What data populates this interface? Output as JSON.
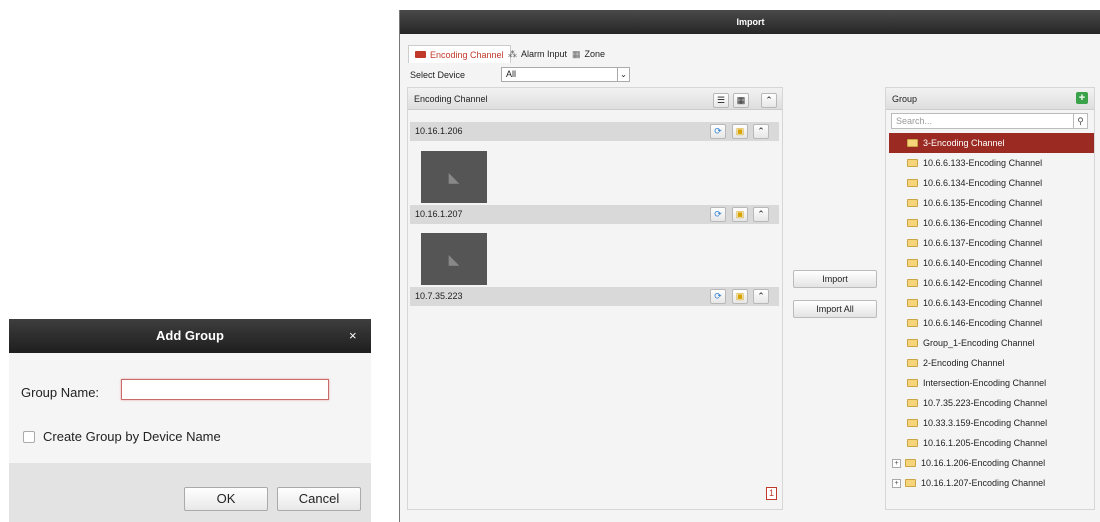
{
  "import_window": {
    "title": "Import",
    "tabs": [
      {
        "label": "Encoding Channel",
        "active": true
      },
      {
        "label": "Alarm Input",
        "active": false
      },
      {
        "label": "Zone",
        "active": false
      }
    ],
    "select_device_label": "Select Device",
    "select_device_value": "All",
    "left_panel": {
      "title": "Encoding Channel",
      "devices": [
        "10.16.1.206",
        "10.16.1.207",
        "10.7.35.223"
      ],
      "page_number": "1"
    },
    "import_button": "Import",
    "import_all_button": "Import All",
    "group_panel": {
      "title": "Group",
      "search_placeholder": "Search...",
      "items": [
        {
          "label": "3-Encoding Channel",
          "selected": true,
          "expandable": false
        },
        {
          "label": "10.6.6.133-Encoding Channel",
          "selected": false,
          "expandable": false
        },
        {
          "label": "10.6.6.134-Encoding Channel",
          "selected": false,
          "expandable": false
        },
        {
          "label": "10.6.6.135-Encoding Channel",
          "selected": false,
          "expandable": false
        },
        {
          "label": "10.6.6.136-Encoding Channel",
          "selected": false,
          "expandable": false
        },
        {
          "label": "10.6.6.137-Encoding Channel",
          "selected": false,
          "expandable": false
        },
        {
          "label": "10.6.6.140-Encoding Channel",
          "selected": false,
          "expandable": false
        },
        {
          "label": "10.6.6.142-Encoding Channel",
          "selected": false,
          "expandable": false
        },
        {
          "label": "10.6.6.143-Encoding Channel",
          "selected": false,
          "expandable": false
        },
        {
          "label": "10.6.6.146-Encoding Channel",
          "selected": false,
          "expandable": false
        },
        {
          "label": "Group_1-Encoding Channel",
          "selected": false,
          "expandable": false
        },
        {
          "label": "2-Encoding Channel",
          "selected": false,
          "expandable": false
        },
        {
          "label": "Intersection-Encoding Channel",
          "selected": false,
          "expandable": false
        },
        {
          "label": "10.7.35.223-Encoding Channel",
          "selected": false,
          "expandable": false
        },
        {
          "label": "10.33.3.159-Encoding Channel",
          "selected": false,
          "expandable": false
        },
        {
          "label": "10.16.1.205-Encoding Channel",
          "selected": false,
          "expandable": false
        },
        {
          "label": "10.16.1.206-Encoding Channel",
          "selected": false,
          "expandable": true
        },
        {
          "label": "10.16.1.207-Encoding Channel",
          "selected": false,
          "expandable": true
        }
      ]
    }
  },
  "add_group_dialog": {
    "title": "Add Group",
    "close_symbol": "×",
    "group_name_label": "Group Name:",
    "group_name_value": "",
    "create_by_device_label": "Create Group by Device Name",
    "create_by_device_checked": false,
    "ok_button": "OK",
    "cancel_button": "Cancel"
  },
  "colors": {
    "accent": "#c0392b",
    "selected_row": "#9a2a22",
    "titlebar": "#2b2b2b"
  }
}
